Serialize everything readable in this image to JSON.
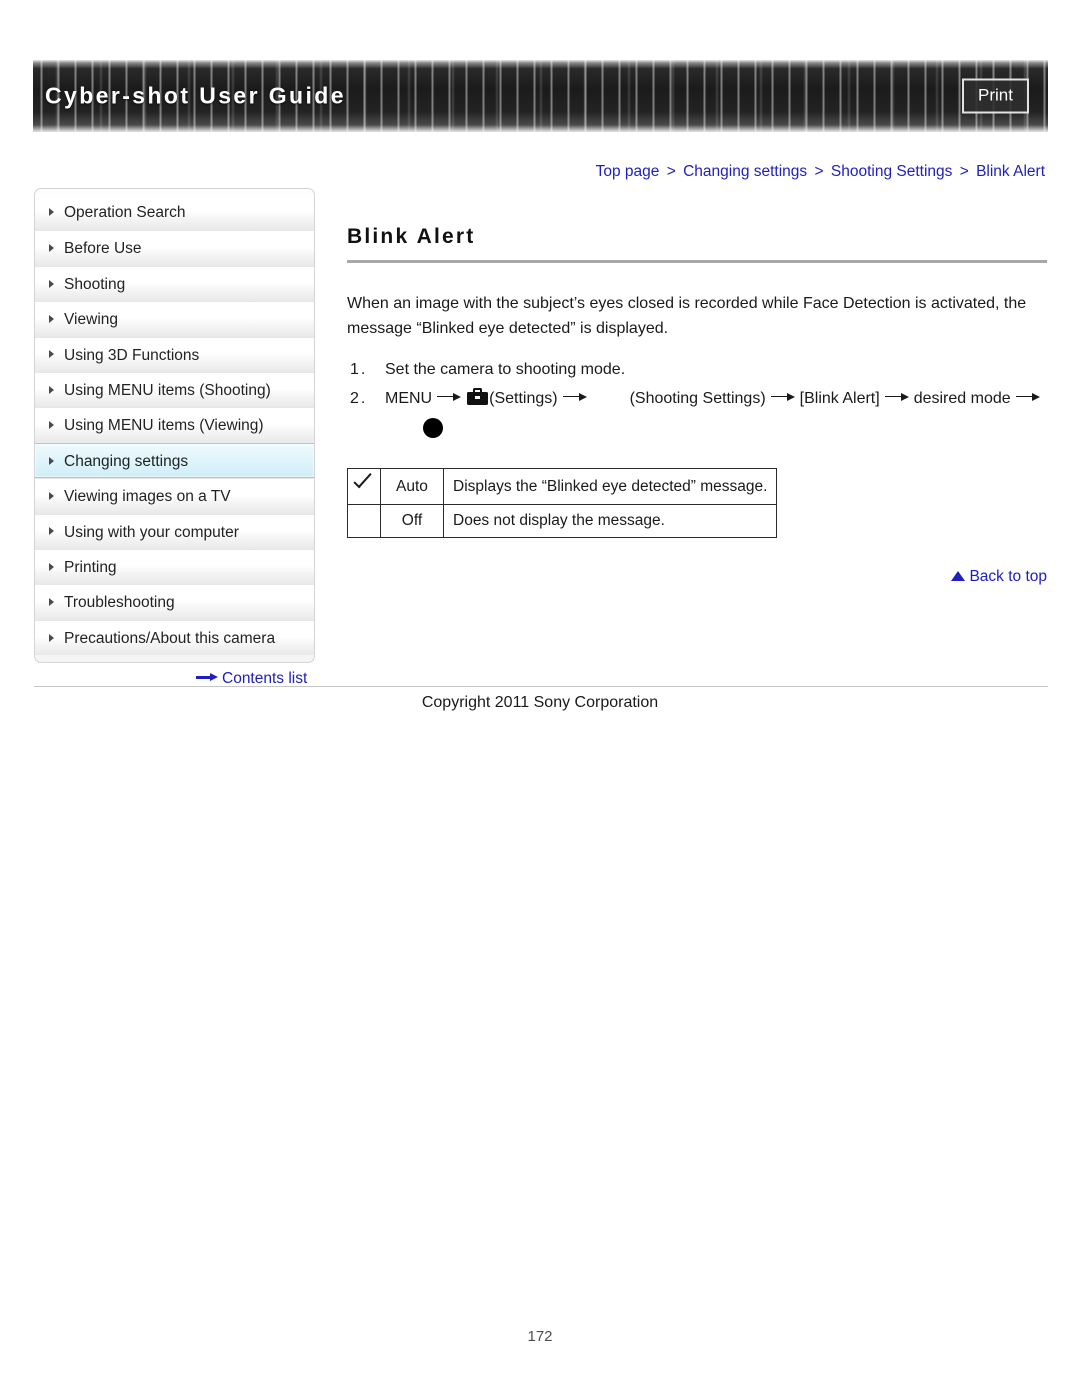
{
  "header": {
    "title": "Cyber-shot User Guide",
    "print_label": "Print"
  },
  "breadcrumb": {
    "separator": ">",
    "items": [
      {
        "label": "Top page"
      },
      {
        "label": "Changing settings"
      },
      {
        "label": "Shooting Settings"
      },
      {
        "label": "Blink Alert"
      }
    ]
  },
  "sidebar": {
    "items": [
      {
        "label": "Operation Search",
        "active": false
      },
      {
        "label": "Before Use",
        "active": false
      },
      {
        "label": "Shooting",
        "active": false
      },
      {
        "label": "Viewing",
        "active": false
      },
      {
        "label": "Using 3D Functions",
        "active": false
      },
      {
        "label": "Using MENU items (Shooting)",
        "active": false
      },
      {
        "label": "Using MENU items (Viewing)",
        "active": false
      },
      {
        "label": "Changing settings",
        "active": true
      },
      {
        "label": "Viewing images on a TV",
        "active": false
      },
      {
        "label": "Using with your computer",
        "active": false
      },
      {
        "label": "Printing",
        "active": false
      },
      {
        "label": "Troubleshooting",
        "active": false
      },
      {
        "label": "Precautions/About this camera",
        "active": false
      }
    ],
    "contents_list_label": "Contents list",
    "contents_list_icon": "arrow-right-icon"
  },
  "main": {
    "heading": "Blink Alert",
    "intro": "When an image with the subject’s eyes closed is recorded while Face Detection is activated, the message “Blinked eye detected” is displayed.",
    "steps": [
      {
        "number": "1.",
        "text": "Set the camera to shooting mode."
      },
      {
        "number": "2.",
        "menu_label": "MENU",
        "settings_icon": "toolbox-icon",
        "settings_label": "(Settings)",
        "shooting_settings_label": "(Shooting Settings)",
        "blink_alert_label": "[Blink Alert]",
        "desired_mode_label": "desired mode",
        "control_dot_icon": "control-center-dot-icon"
      }
    ],
    "options_table": {
      "rows": [
        {
          "checked": true,
          "check_icon": "checkmark-icon",
          "label": "Auto",
          "description": "Displays the “Blinked eye detected” message."
        },
        {
          "checked": false,
          "check_icon": "",
          "label": "Off",
          "description": "Does not display the message."
        }
      ]
    },
    "back_to_top_label": "Back to top",
    "back_to_top_icon": "triangle-up-icon"
  },
  "footer": {
    "copyright": "Copyright 2011 Sony Corporation",
    "page_number": "172"
  },
  "colors": {
    "link": "#2020c0",
    "active_sidebar_bg": "#dff4fb",
    "active_sidebar_border": "#8bd3e6",
    "heading_rule": "#a8a8a8",
    "table_border": "#2b2b2b"
  }
}
